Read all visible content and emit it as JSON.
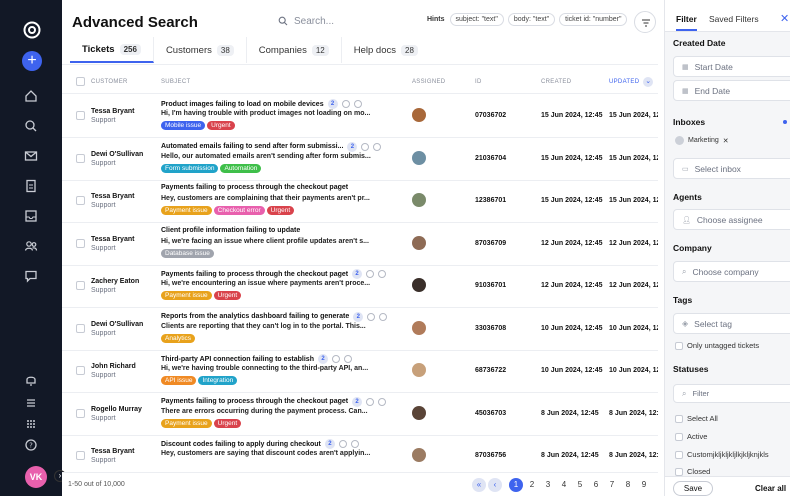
{
  "header": {
    "title": "Advanced Search",
    "search_placeholder": "Search...",
    "hints_label": "Hints",
    "hint_chips": [
      "subject: \"text\"",
      "body: \"text\"",
      "ticket id: \"number\""
    ]
  },
  "tabs": [
    {
      "label": "Tickets",
      "count": "256"
    },
    {
      "label": "Customers",
      "count": "38"
    },
    {
      "label": "Companies",
      "count": "12"
    },
    {
      "label": "Help docs",
      "count": "28"
    }
  ],
  "columns": {
    "customer": "CUSTOMER",
    "subject": "SUBJECT",
    "assigned": "ASSIGNED",
    "id": "ID",
    "created": "CREATED",
    "updated": "UPDATED"
  },
  "rows": [
    {
      "customer": "Tessa Bryant",
      "team": "Support",
      "subject": "Product images failing to load on mobile devices",
      "count": "2",
      "preview": "Hi, I'm having trouble with product images not loading on mo...",
      "tags": [
        "Mobile issue",
        "Urgent"
      ],
      "id": "07036702",
      "created": "15 Jun 2024, 12:45",
      "updated": "15 Jun 2024, 12:45"
    },
    {
      "customer": "Dewi O'Sullivan",
      "team": "Support",
      "subject": "Automated emails failing to send after form submissi...",
      "count": "2",
      "preview": "Hello, our automated emails aren't sending after form submis...",
      "tags": [
        "Form submission",
        "Automation"
      ],
      "id": "21036704",
      "created": "15 Jun 2024, 12:45",
      "updated": "15 Jun 2024, 12:45"
    },
    {
      "customer": "Tessa Bryant",
      "team": "Support",
      "subject": "Payments failing to process through the checkout paget",
      "count": "",
      "preview": "Hey, customers are complaining that their payments aren't pr...",
      "tags": [
        "Payment issue",
        "Checkout error",
        "Urgent"
      ],
      "id": "12386701",
      "created": "15 Jun 2024, 12:45",
      "updated": "15 Jun 2024, 12:45"
    },
    {
      "customer": "Tessa Bryant",
      "team": "Support",
      "subject": "Client profile information failing to update",
      "count": "",
      "preview": "Hi, we're facing an issue where client profile updates aren't s...",
      "tags": [
        "Database issue"
      ],
      "id": "87036709",
      "created": "12 Jun 2024, 12:45",
      "updated": "12 Jun 2024, 12:45"
    },
    {
      "customer": "Zachery Eaton",
      "team": "Support",
      "subject": "Payments failing to process through the checkout paget",
      "count": "2",
      "preview": "Hi, we're encountering an issue where payments aren't proce...",
      "tags": [
        "Payment issue",
        "Urgent"
      ],
      "id": "91036701",
      "created": "12 Jun 2024, 12:45",
      "updated": "12 Jun 2024, 12:45"
    },
    {
      "customer": "Dewi O'Sullivan",
      "team": "Support",
      "subject": "Reports from the analytics dashboard failing to generate",
      "count": "2",
      "preview": "Clients are reporting that they can't log in to the portal. This...",
      "tags": [
        "Analytics"
      ],
      "id": "33036708",
      "created": "10 Jun 2024, 12:45",
      "updated": "10 Jun 2024, 12:45"
    },
    {
      "customer": "John Richard",
      "team": "Support",
      "subject": "Third-party API connection failing to establish",
      "count": "2",
      "preview": "Hi, we're having trouble connecting to the third-party API, an...",
      "tags": [
        "API issue",
        "Integration"
      ],
      "id": "68736722",
      "created": "10 Jun 2024, 12:45",
      "updated": "10 Jun 2024, 12:45"
    },
    {
      "customer": "Rogello Murray",
      "team": "Support",
      "subject": "Payments failing to process through the checkout paget",
      "count": "2",
      "preview": "There are errors occurring during the payment process. Can...",
      "tags": [
        "Payment issue",
        "Urgent"
      ],
      "id": "45036703",
      "created": "8 Jun 2024, 12:45",
      "updated": "8 Jun 2024, 12:45"
    },
    {
      "customer": "Tessa Bryant",
      "team": "Support",
      "subject": "Discount codes failing to apply during checkout",
      "count": "2",
      "preview": "Hey, customers are saying that discount codes aren't applyin...",
      "tags": [],
      "id": "87036756",
      "created": "8 Jun 2024, 12:45",
      "updated": "8 Jun 2024, 12:45"
    }
  ],
  "tag_colors": {
    "Mobile issue": "#3e63ee",
    "Urgent": "#d9434c",
    "Form submission": "#21a3c9",
    "Automation": "#3fbf4a",
    "Payment issue": "#e8a21c",
    "Checkout error": "#e860ad",
    "Database issue": "#a0a4ad",
    "Analytics": "#e8a21c",
    "API issue": "#f08a24",
    "Integration": "#21a3c9"
  },
  "footer": {
    "count": "1-50 out of 10,000",
    "pages": [
      "1",
      "2",
      "3",
      "4",
      "5",
      "6",
      "7",
      "8",
      "9"
    ]
  },
  "avatar_initials": "VK",
  "panel": {
    "tabs": [
      "Filter",
      "Saved Filters"
    ],
    "created_date": "Created Date",
    "start_date": "Start Date",
    "end_date": "End Date",
    "inboxes": "Inboxes",
    "marketing": "Marketing",
    "select_inbox": "Select inbox",
    "agents": "Agents",
    "choose_assignee": "Choose assignee",
    "company": "Company",
    "choose_company": "Choose company",
    "tags": "Tags",
    "select_tag": "Select tag",
    "only_untagged": "Only untagged tickets",
    "statuses": "Statuses",
    "filter_placeholder": "Filter",
    "select_all": "Select All",
    "active": "Active",
    "custom": "Customjkljkljkljlkjkljknjkls",
    "closed": "Closed",
    "save": "Save",
    "clear_all": "Clear all"
  }
}
